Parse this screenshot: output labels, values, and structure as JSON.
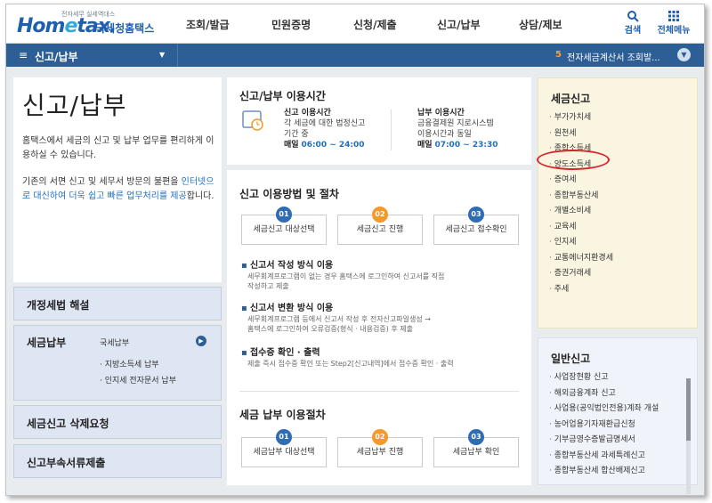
{
  "logo": {
    "small": "전자세무 실세역대스",
    "main_a": "Hom",
    "main_e": "e",
    "main_b": "tax.",
    "kr": "국세청홈택스"
  },
  "nav": {
    "items": [
      "조회/발급",
      "민원증명",
      "신청/제출",
      "신고/납부",
      "상담/제보"
    ],
    "search": "검색",
    "all_menu": "전체메뉴"
  },
  "subbar": {
    "menu_icon": "≡",
    "crumb": "신고/납부",
    "notice_num": "5",
    "notice": "전자세금계산서 조회발..."
  },
  "intro": {
    "title": "신고/납부",
    "p1": "홈택스에서 세금의 신고 및 납부 업무를 편리하게 이용하실 수 있습니다.",
    "p2a": "기존의 서면 신고 및 세무서 방문의 불편을 ",
    "p2b": "인터넷으로 대신하여 더욱 쉽고 빠른 업무처리를 제공",
    "p2c": "합니다."
  },
  "left_menu": {
    "revision": "개정세법 해설",
    "payment": {
      "title": "세금납부",
      "items": [
        "국세납부",
        "지방소득세 납부",
        "인지세 전자문서 납부"
      ]
    },
    "delete_request": "세금신고 삭제요청",
    "attach_submit": "신고부속서류제출"
  },
  "hours": {
    "title": "신고/납부 이용시간",
    "filing": {
      "label": "신고 이용시간",
      "desc1": "각 세금에 대한 법정신고",
      "desc2": "기간 중",
      "day": "매일",
      "time": "06:00 ~ 24:00"
    },
    "payment": {
      "label": "납부 이용시간",
      "desc1": "금융결제원 지로시스템",
      "desc2": "이용시간과 동일",
      "day": "매일",
      "time": "07:00 ~ 23:30"
    }
  },
  "procedure": {
    "title": "신고 이용방법 및 절차",
    "steps": [
      {
        "num": "01",
        "label": "세금신고 대상선택"
      },
      {
        "num": "02",
        "label": "세금신고 진행"
      },
      {
        "num": "03",
        "label": "세금신고 접수확인"
      }
    ],
    "methods": [
      {
        "title": "신고서 작성 방식 이용",
        "desc1": "세무회계프로그램이 없는 경우 홈택스에 로그인하여 신고서를 직접",
        "desc2": "작성하고 제출"
      },
      {
        "title": "신고서 변환 방식 이용",
        "desc1": "세무회계프로그램 등에서 신고서 작성 후 전자신고파일생성 →",
        "desc2": "홈택스에 로그인하여 오류검증(형식 · 내용검증) 후 제출"
      },
      {
        "title": "접수증 확인 · 출력",
        "desc1": "제출 즉시 접수증 확인 또는 Step2[신고내역]에서 접수증 확인 · 출력",
        "desc2": ""
      }
    ],
    "pay_title": "세금 납부 이용절차",
    "pay_steps": [
      {
        "num": "01",
        "label": "세금납부 대상선택"
      },
      {
        "num": "02",
        "label": "세금납부 진행"
      },
      {
        "num": "03",
        "label": "세금납부 확인"
      }
    ]
  },
  "tax_filing": {
    "title": "세금신고",
    "items": [
      "부가가치세",
      "원천세",
      "종합소득세",
      "양도소득세",
      "증여세",
      "종합부동산세",
      "개별소비세",
      "교육세",
      "인지세",
      "교통에너지환경세",
      "증권거래세",
      "주세"
    ]
  },
  "general_filing": {
    "title": "일반신고",
    "items": [
      "사업장현황 신고",
      "해외금융계좌 신고",
      "사업용(공익법인전용)계좌 개설",
      "농어업용기자재환급신청",
      "기부금영수증발급명세서",
      "종합부동산세 과세특례신고",
      "종합부동산세 합산배제신고"
    ]
  },
  "colors": {
    "accent": "#2d5f96",
    "highlight_circle": "#d8262a",
    "step_blue": "#2f6cb3",
    "step_orange": "#f39a2a"
  }
}
